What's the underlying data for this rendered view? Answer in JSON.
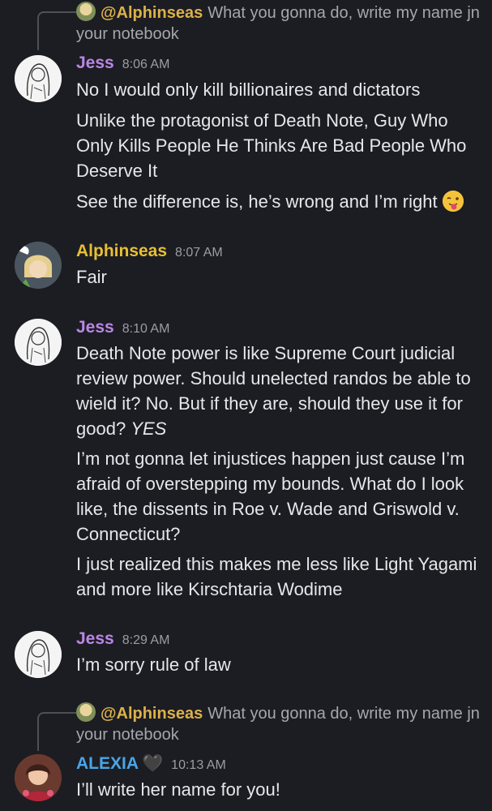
{
  "replies": [
    {
      "mention": "@Alphinseas",
      "text": "What you gonna do, write my name jn your notebook"
    },
    {
      "mention": "@Alphinseas",
      "text": "What you gonna do, write my name jn your notebook"
    }
  ],
  "messages": [
    {
      "author": "Jess",
      "time": "8:06 AM",
      "lines": [
        "No I would only kill billionaires and dictators",
        "Unlike the protagonist of Death Note, Guy Who Only Kills People He Thinks Are Bad People Who Deserve It",
        "See the difference is, he’s wrong and I’m right"
      ]
    },
    {
      "author": "Alphinseas",
      "time": "8:07 AM",
      "lines": [
        "Fair"
      ]
    },
    {
      "author": "Jess",
      "time": "8:10 AM",
      "lines": [
        "Death Note power is like Supreme Court judicial review power. Should unelected randos be able to wield it? No. But if they are, should they use it for good?",
        "YES",
        "I’m not gonna let injustices happen just cause I’m afraid of overstepping my bounds. What do I look like, the dissents in Roe v. Wade and Griswold v. Connecticut?",
        "I just realized this makes me less like Light Yagami and more like Kirschtaria Wodime"
      ]
    },
    {
      "author": "Jess",
      "time": "8:29 AM",
      "lines": [
        "I’m sorry rule of law"
      ]
    },
    {
      "author": "ALEXIA",
      "time": "10:13 AM",
      "lines": [
        "I’ll write her name for you!"
      ]
    }
  ],
  "icons": {
    "emoji": "tongue-out-wink-face",
    "heart": "black-heart"
  },
  "colors": {
    "background": "#1c1d22",
    "jess": "#b987e6",
    "alphinseas": "#e8bf35",
    "alexia": "#4aa5e8",
    "mention": "#dcb14a"
  }
}
